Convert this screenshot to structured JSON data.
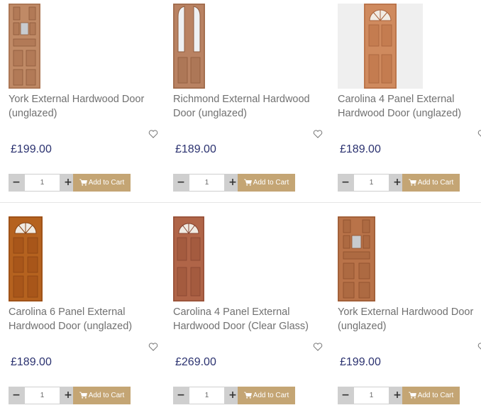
{
  "products": [
    {
      "name": "York External Hardwood Door (unglazed)",
      "price": "£199.00",
      "qty": "1",
      "cart_label": "Add to Cart",
      "icon": "heart-icon"
    },
    {
      "name": "Richmond External Hardwood Door (unglazed)",
      "price": "£189.00",
      "qty": "1",
      "cart_label": "Add to Cart",
      "icon": "heart-icon"
    },
    {
      "name": "Carolina 4 Panel External Hardwood Door (unglazed)",
      "price": "£189.00",
      "qty": "1",
      "cart_label": "Add to Cart",
      "icon": "heart-icon"
    },
    {
      "name": "Carolina 6 Panel External Hardwood Door (unglazed)",
      "price": "£189.00",
      "qty": "1",
      "cart_label": "Add to Cart",
      "icon": "heart-icon"
    },
    {
      "name": "Carolina 4 Panel External Hardwood Door (Clear Glass)",
      "price": "£269.00",
      "qty": "1",
      "cart_label": "Add to Cart",
      "icon": "heart-icon"
    },
    {
      "name": "York External Hardwood Door (unglazed)",
      "price": "£199.00",
      "qty": "1",
      "cart_label": "Add to Cart",
      "icon": "heart-icon"
    }
  ],
  "controls": {
    "minus": "−",
    "plus": "+"
  },
  "colors": {
    "price": "#2b3270",
    "cart_button": "#c4a574",
    "qty_button": "#cfcfcf",
    "door_wood": "#b07a55"
  }
}
